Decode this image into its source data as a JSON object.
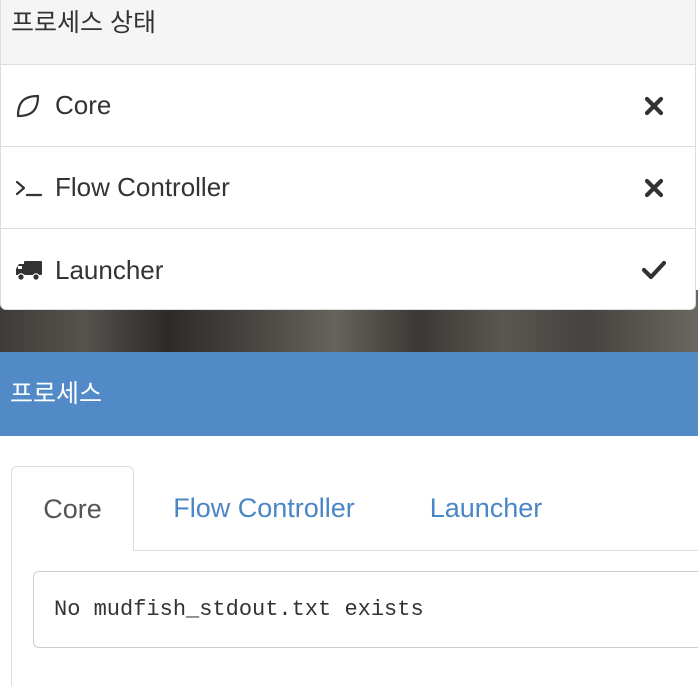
{
  "status_panel": {
    "title": "프로세스 상태",
    "rows": [
      {
        "label": "Core",
        "icon": "leaf-icon",
        "state": "stopped",
        "state_icon": "x-mark-icon"
      },
      {
        "label": "Flow Controller",
        "icon": "terminal-icon",
        "state": "stopped",
        "state_icon": "x-mark-icon"
      },
      {
        "label": "Launcher",
        "icon": "truck-icon",
        "state": "running",
        "state_icon": "checkmark-icon"
      }
    ]
  },
  "process_panel": {
    "title": "프로세스",
    "tabs": [
      {
        "label": "Core",
        "active": true
      },
      {
        "label": "Flow Controller",
        "active": false
      },
      {
        "label": "Launcher",
        "active": false
      }
    ],
    "log_message": "No mudfish_stdout.txt exists"
  },
  "colors": {
    "header_blue": "#5289c7",
    "link_blue": "#4a86c6",
    "border": "#dddddd"
  }
}
